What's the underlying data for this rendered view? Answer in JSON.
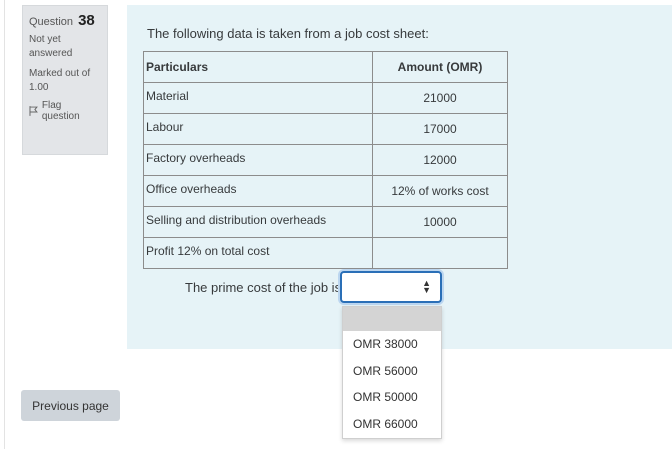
{
  "question_info": {
    "question_prefix": "Question",
    "question_number": "38",
    "state": "Not yet answered",
    "grade": "Marked out of 1.00",
    "flag_label": "Flag question"
  },
  "question": {
    "text": "The following data is taken from a job cost sheet:",
    "table": {
      "headers": [
        "Particulars",
        "Amount (OMR)"
      ],
      "rows": [
        [
          "Material",
          "21000"
        ],
        [
          "Labour",
          "17000"
        ],
        [
          "Factory overheads",
          "12000"
        ],
        [
          "Office overheads",
          "12% of works cost"
        ],
        [
          "Selling and distribution overheads",
          "10000"
        ],
        [
          "Profit 12% on total cost",
          ""
        ]
      ]
    },
    "prompt": "The prime cost of the job is:",
    "select_value": "",
    "options": [
      "",
      "OMR 38000",
      "OMR 56000",
      "OMR 50000",
      "OMR 66000"
    ]
  },
  "navigation": {
    "previous_label": "Previous page"
  }
}
